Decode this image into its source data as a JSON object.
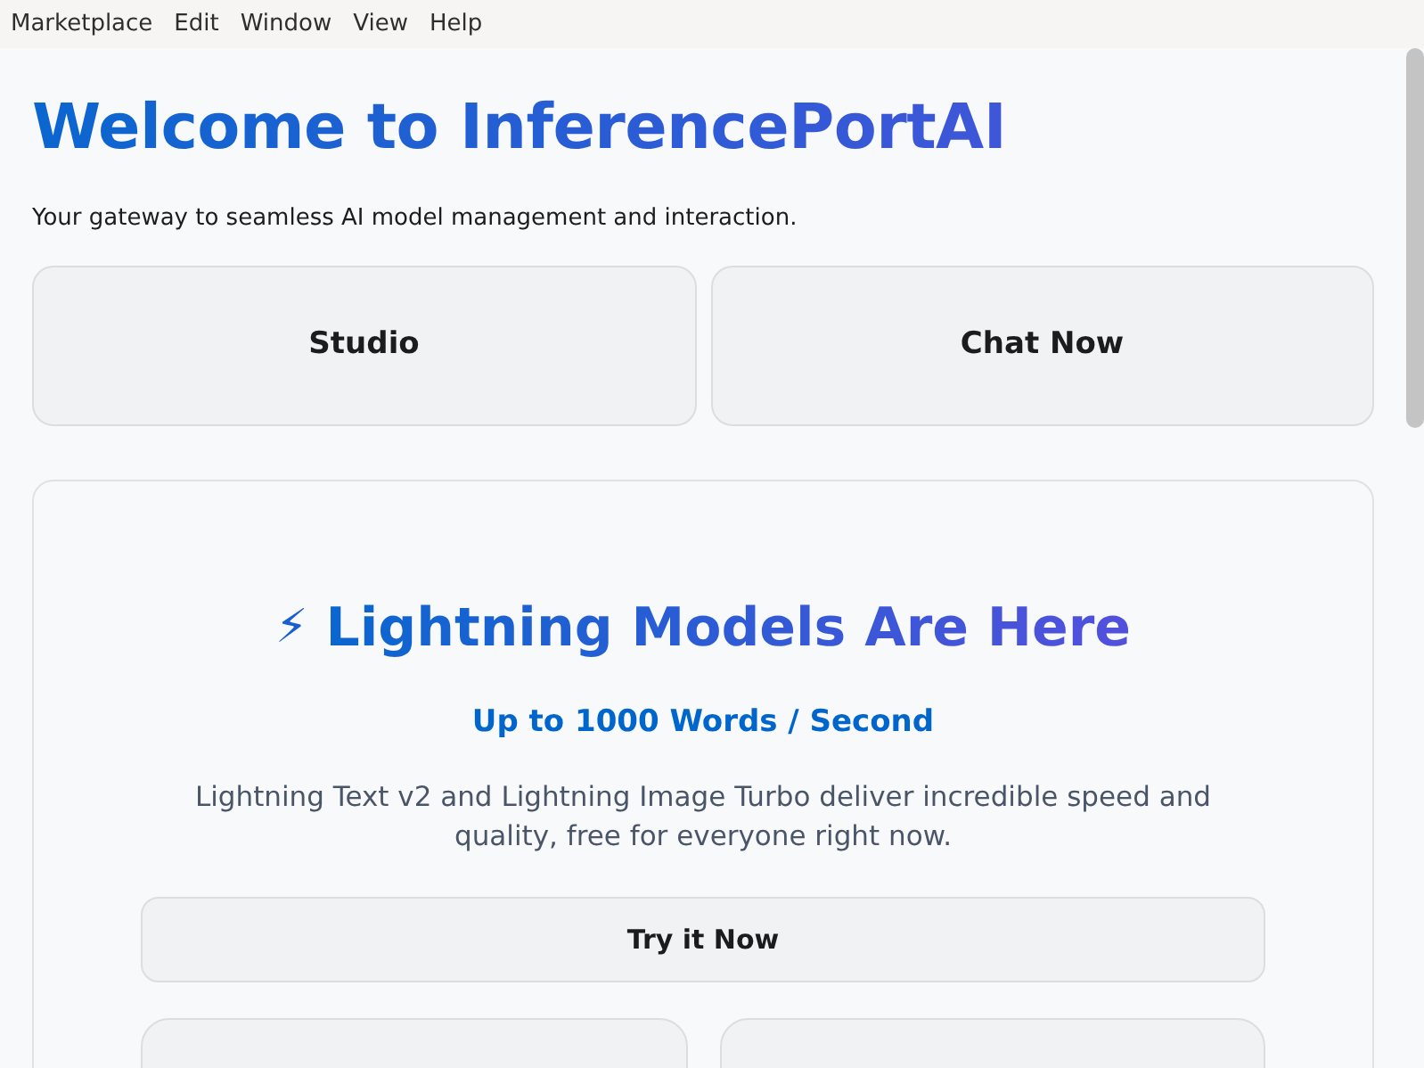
{
  "menu_bar": [
    "Marketplace",
    "Edit",
    "Window",
    "View",
    "Help"
  ],
  "title": "Welcome to InferencePortAI",
  "subtitle": "Your gateway to seamless AI model management and interaction.",
  "actions": [
    "Studio",
    "Chat Now"
  ],
  "promo": {
    "icon": "⚡",
    "heading": "Lightning Models Are Here",
    "tagline": "Up to 1000 Words / Second",
    "description": "Lightning Text v2 and Lightning Image Turbo deliver incredible speed and quality, free for everyone right now.",
    "button": "Try it Now"
  }
}
